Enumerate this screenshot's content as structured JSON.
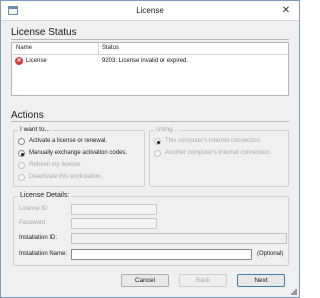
{
  "window": {
    "title": "License",
    "close_glyph": "✕"
  },
  "license_status": {
    "heading": "License Status",
    "columns": {
      "name": "Name",
      "status": "Status"
    },
    "rows": [
      {
        "icon": "error-icon",
        "name": "License",
        "status": "9203: License invalid or expired."
      }
    ]
  },
  "actions": {
    "heading": "Actions",
    "i_want_to": {
      "legend": "I want to...",
      "options": [
        {
          "label": "Activate a license or renewal.",
          "selected": false,
          "enabled": true
        },
        {
          "label": "Manually exchange activation codes.",
          "selected": true,
          "enabled": true
        },
        {
          "label": "Refresh my license.",
          "selected": false,
          "enabled": false
        },
        {
          "label": "Deactivate this workstation.",
          "selected": false,
          "enabled": false
        }
      ]
    },
    "using": {
      "legend": "Using...",
      "options": [
        {
          "label": "This computer's Internet connection.",
          "selected": true,
          "enabled": false
        },
        {
          "label": "Another computer's Internet connection.",
          "selected": false,
          "enabled": false
        }
      ]
    }
  },
  "license_details": {
    "legend": "License Details:",
    "license_id_label": "License ID:",
    "license_id_value": "",
    "password_label": "Password:",
    "password_value": "",
    "installation_id_label": "Installation ID:",
    "installation_id_value": "",
    "installation_name_label": "Installation Name:",
    "installation_name_value": "",
    "optional_label": "(Optional)"
  },
  "buttons": {
    "cancel": "Cancel",
    "back": "Back",
    "next": "Next"
  }
}
